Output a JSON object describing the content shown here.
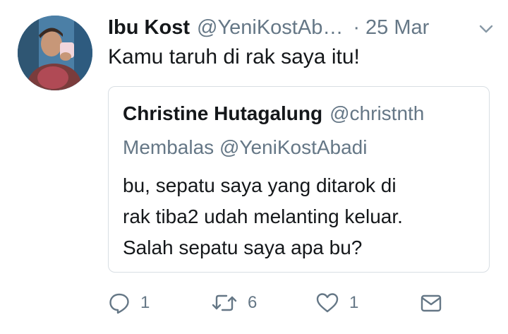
{
  "tweet": {
    "author_name": "Ibu Kost",
    "author_handle": "@YeniKostAb…",
    "separator": "·",
    "timestamp": "25 Mar",
    "text": "Kamu taruh di rak saya itu!"
  },
  "quoted": {
    "author_name": "Christine Hutagalung",
    "author_handle": "@christnth",
    "reply_context": "Membalas @YeniKostAbadi",
    "text_lines": [
      "bu, sepatu saya yang ditarok di",
      "rak tiba2 udah melanting keluar.",
      "Salah sepatu saya apa bu?"
    ]
  },
  "actions": {
    "reply_count": "1",
    "retweet_count": "6",
    "like_count": "1"
  },
  "icons": [
    "chevron-down-icon",
    "reply-icon",
    "retweet-icon",
    "like-icon",
    "message-icon"
  ],
  "colors": {
    "text": "#14171a",
    "secondary": "#657786",
    "border": "#d8dee3"
  }
}
